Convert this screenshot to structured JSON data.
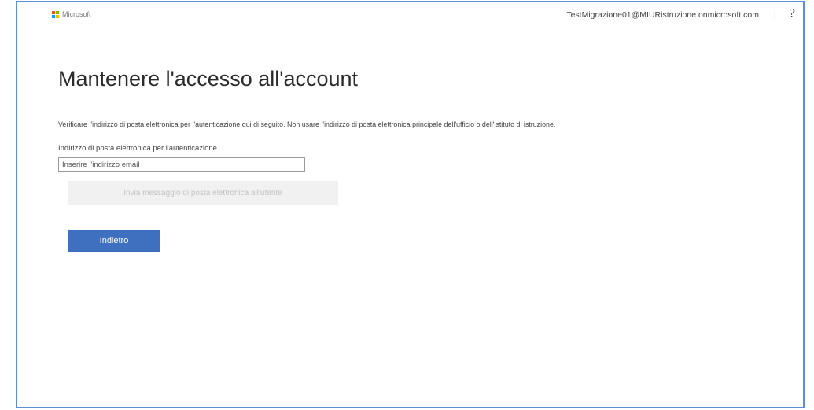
{
  "header": {
    "brand": "Microsoft",
    "user_email": "TestMigrazione01@MIURistruzione.onmicrosoft.com",
    "separator": "|",
    "help_label": "?"
  },
  "main": {
    "title": "Mantenere l'accesso all'account",
    "description": "Verificare l'indirizzo di posta elettronica per l'autenticazione qui di seguito. Non usare l'indirizzo di posta elettronica principale dell'ufficio o dell'istituto di istruzione.",
    "email_label": "Indirizzo di posta elettronica per l'autenticazione",
    "email_placeholder": "Inserire l'indirizzo email",
    "email_value": "",
    "send_button_label": "Invia messaggio di posta elettronica all'utente",
    "back_button_label": "Indietro"
  },
  "colors": {
    "frame_border": "#5b8ed6",
    "primary_button": "#3f6fbf",
    "disabled_button": "#f1f1f1",
    "ms_red": "#f25022",
    "ms_green": "#7fba00",
    "ms_blue": "#00a4ef",
    "ms_yellow": "#ffb900"
  }
}
